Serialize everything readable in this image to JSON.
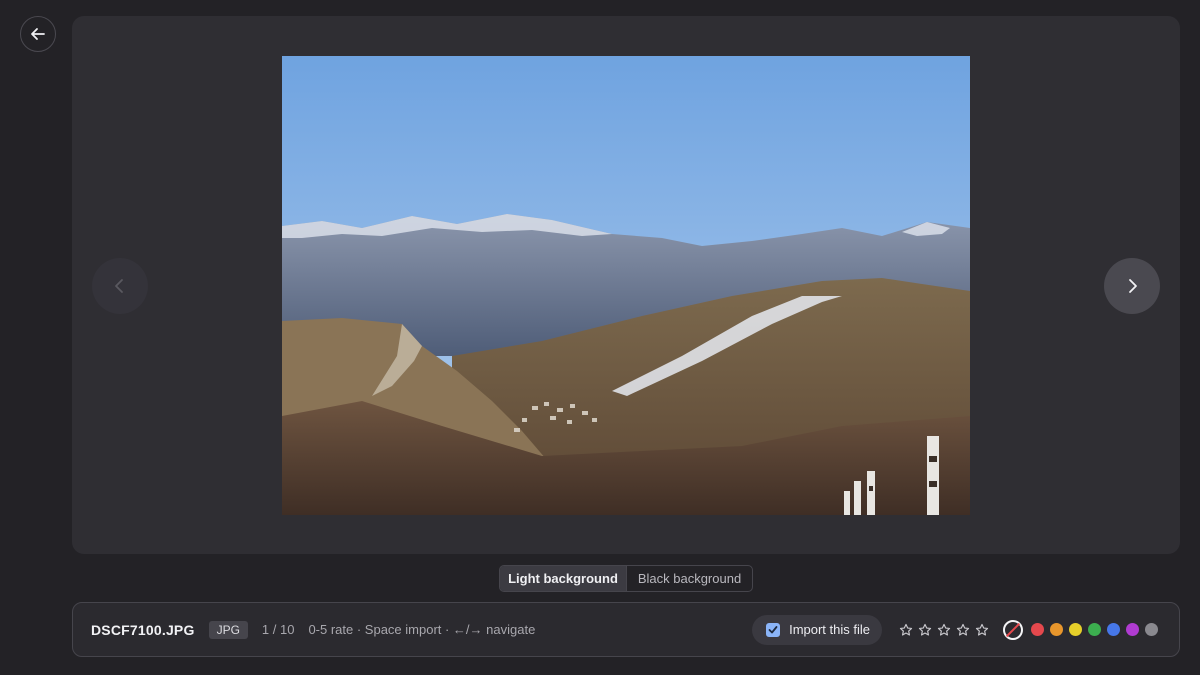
{
  "viewer": {
    "prev_icon": "chevron-left-icon",
    "next_icon": "chevron-right-icon",
    "back_icon": "arrow-left-icon"
  },
  "background_toggle": {
    "options": [
      "Light background",
      "Black background"
    ],
    "selected": "Light background"
  },
  "footer": {
    "filename": "DSCF7100.JPG",
    "type": "JPG",
    "counter": "1 / 10",
    "hints": "0-5 rate · Space import · ←/→ navigate",
    "import_label": "Import this file",
    "import_checked": true,
    "rating": {
      "value": 0,
      "max": 5
    },
    "color_labels": [
      {
        "name": "none",
        "color": "#ffffff"
      },
      {
        "name": "red",
        "color": "#e5484d"
      },
      {
        "name": "orange",
        "color": "#e8962c"
      },
      {
        "name": "yellow",
        "color": "#e6cf2a"
      },
      {
        "name": "green",
        "color": "#3cae4f"
      },
      {
        "name": "blue",
        "color": "#4677e8"
      },
      {
        "name": "purple",
        "color": "#b03bd1"
      },
      {
        "name": "gray",
        "color": "#8a898f"
      }
    ]
  }
}
